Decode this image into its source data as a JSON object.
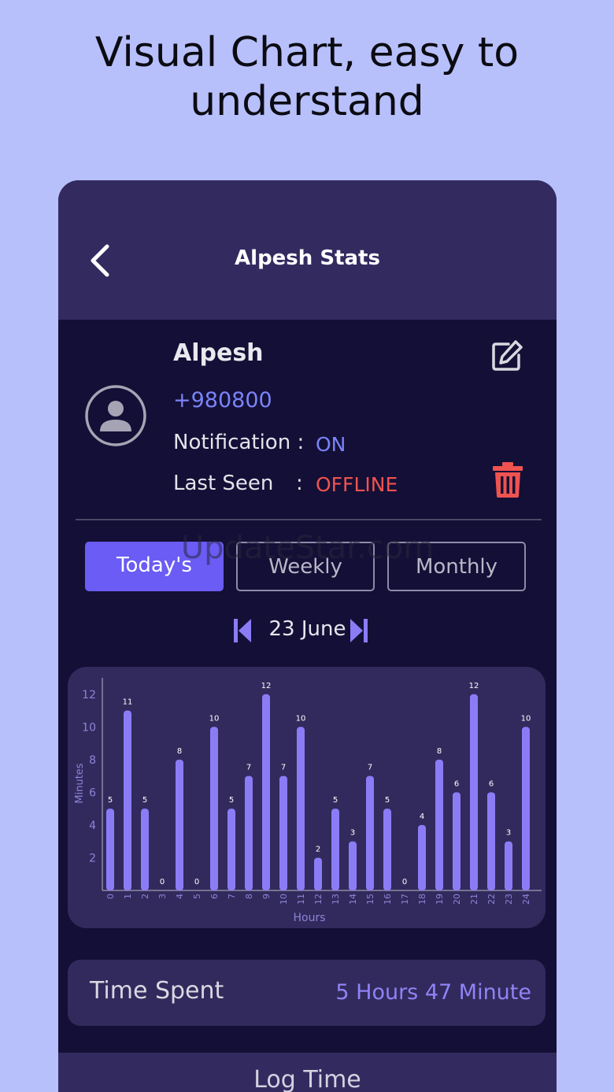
{
  "headline": {
    "line1": "Visual Chart, easy to",
    "line2": "understand"
  },
  "appbar": {
    "title": "Alpesh Stats",
    "back_icon": "chevron-left-icon"
  },
  "profile": {
    "name": "Alpesh",
    "phone": "+980800",
    "notification_label": "Notification :",
    "notification_value": "ON",
    "last_seen_label": "Last Seen",
    "last_seen_colon": ":",
    "last_seen_value": "OFFLINE",
    "avatar_icon": "person-circle-icon",
    "edit_icon": "edit-icon",
    "delete_icon": "trash-icon"
  },
  "tabs": [
    {
      "label": "Today's",
      "active": true
    },
    {
      "label": "Weekly",
      "active": false
    },
    {
      "label": "Monthly",
      "active": false
    }
  ],
  "watermark": "UpdateStar.com",
  "date_nav": {
    "date": "23 June",
    "prev_icon": "skip-previous-icon",
    "next_icon": "skip-next-icon"
  },
  "chart_data": {
    "type": "bar",
    "categories": [
      "0",
      "1",
      "2",
      "3",
      "4",
      "5",
      "6",
      "7",
      "8",
      "9",
      "10",
      "11",
      "12",
      "13",
      "14",
      "15",
      "16",
      "17",
      "18",
      "19",
      "20",
      "21",
      "22",
      "23",
      "24"
    ],
    "values": [
      5,
      11,
      5,
      0,
      8,
      0,
      10,
      5,
      7,
      12,
      7,
      10,
      2,
      5,
      3,
      7,
      5,
      0,
      4,
      8,
      6,
      12,
      6,
      3,
      10
    ],
    "xlabel": "Hours",
    "ylabel": "Minutes",
    "yticks": [
      2,
      4,
      6,
      8,
      10,
      12
    ],
    "ylim": [
      0,
      13
    ],
    "grid": false,
    "bar_color": "#8b7cf6"
  },
  "time_spent": {
    "label": "Time Spent",
    "value": "5 Hours 47 Minute"
  },
  "log_button": {
    "label": "Log Time"
  },
  "colors": {
    "background": "#b7c0fb",
    "phone_bg": "#140f36",
    "card_bg": "#322a5c",
    "accent": "#6a5cf4",
    "link_blue": "#7a84f8",
    "danger": "#ef5350"
  }
}
